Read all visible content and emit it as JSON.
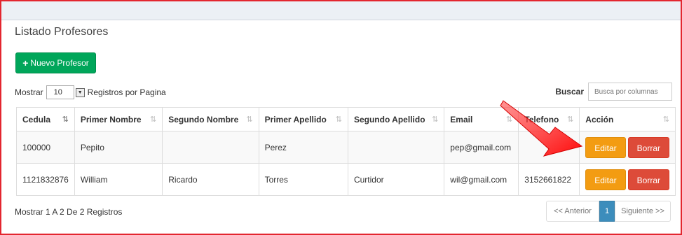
{
  "page": {
    "title": "Listado Profesores"
  },
  "toolbar": {
    "new_label": "Nuevo Profesor"
  },
  "length": {
    "prefix": "Mostrar",
    "value": "10",
    "suffix": "Registros por Pagina"
  },
  "search": {
    "label": "Buscar",
    "placeholder": "Busca por columnas"
  },
  "table": {
    "headers": [
      "Cedula",
      "Primer Nombre",
      "Segundo Nombre",
      "Primer Apellido",
      "Segundo Apellido",
      "Email",
      "Telefono",
      "Acción"
    ],
    "rows": [
      {
        "cedula": "100000",
        "primer_nombre": "Pepito",
        "segundo_nombre": "",
        "primer_apellido": "Perez",
        "segundo_apellido": "",
        "email": "pep@gmail.com",
        "telefono": "",
        "edit": "Editar",
        "delete": "Borrar"
      },
      {
        "cedula": "1121832876",
        "primer_nombre": "William",
        "segundo_nombre": "Ricardo",
        "primer_apellido": "Torres",
        "segundo_apellido": "Curtidor",
        "email": "wil@gmail.com",
        "telefono": "3152661822",
        "edit": "Editar",
        "delete": "Borrar"
      }
    ]
  },
  "footer": {
    "info": "Mostrar 1 A 2 De 2 Registros"
  },
  "pagination": {
    "prev": "<< Anterior",
    "current": "1",
    "next": "Siguiente >>"
  },
  "colors": {
    "accent_frame": "#e3262f",
    "success": "#00a65a",
    "warning": "#f39c12",
    "danger": "#dd4b39",
    "primary": "#3c8dbc"
  }
}
